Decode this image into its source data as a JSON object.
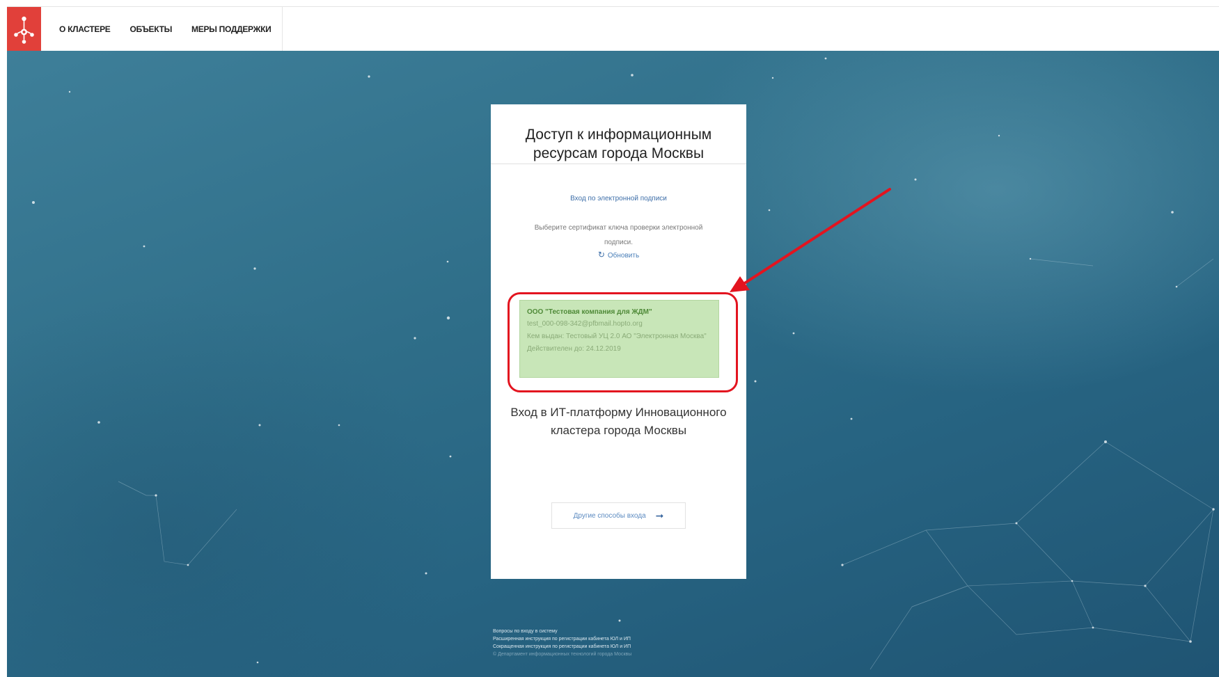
{
  "header": {
    "nav": [
      "О КЛАСТЕРЕ",
      "ОБЪЕКТЫ",
      "МЕРЫ ПОДДЕРЖКИ"
    ]
  },
  "card": {
    "title": "Доступ к информационным ресурсам города Москвы",
    "signature_link": "Вход по электронной подписи",
    "instruction": "Выберите сертификат ключа проверки электронной подписи.",
    "refresh_label": "Обновить",
    "certificate": {
      "name": "ООО \"Тестовая компания для ЖДМ\"",
      "email": "test_000-098-342@pfbmail.hopto.org",
      "issuer": "Кем выдан: Тестовый УЦ 2.0 АО \"Электронная Москва\"",
      "valid_until": "Действителен до: 24.12.2019"
    },
    "platform_text": "Вход в ИТ-платформу Инновационного кластера города Москвы",
    "other_login_label": "Другие способы входа"
  },
  "footer": {
    "links": [
      "Вопросы по входу в систему",
      "Расширенная инструкция по регистрации кабинета ЮЛ и ИП",
      "Сокращенная инструкция по регистрации кабинета ЮЛ и ИП"
    ],
    "copyright": "© Департамент информационных технологий города Москвы"
  },
  "icons": {
    "refresh": "refresh-icon",
    "arrow": "arrow-right-icon",
    "logo": "cluster-logo-icon"
  },
  "colors": {
    "brand_red": "#e1403a",
    "highlight_red": "#e3141f",
    "certificate_green": "#c8e6b8",
    "background_teal": "#2f6e89"
  }
}
